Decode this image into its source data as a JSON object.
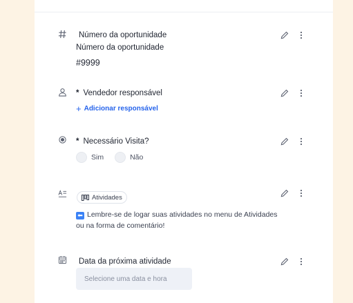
{
  "fields": {
    "opportunity_number": {
      "icon": "hash-icon",
      "label": "Número da oportunidade",
      "sublabel": "Número da oportunidade",
      "value": "#9999"
    },
    "salesperson": {
      "icon": "user-icon",
      "required_mark": "*",
      "label": "Vendedor responsável",
      "add_link": "Adicionar responsável",
      "add_prefix": "+"
    },
    "visit_needed": {
      "icon": "radio-icon",
      "required_mark": "*",
      "label": "Necessário Visita?",
      "options": [
        "Sim",
        "Não"
      ]
    },
    "activities": {
      "icon": "text-format-icon",
      "tag_label": "Atividades",
      "note_arrow": "⬅",
      "note": "Lembre-se de logar suas atividades no menu de Atividades ou na forma de comentário!"
    },
    "next_activity_date": {
      "icon": "calendar-icon",
      "label": "Data da próxima atividade",
      "placeholder": "Selecione uma data e hora"
    }
  },
  "colors": {
    "background": "#fdf3e4",
    "panel": "#ffffff",
    "link": "#2563eb",
    "input_bg": "#eef1f7"
  }
}
